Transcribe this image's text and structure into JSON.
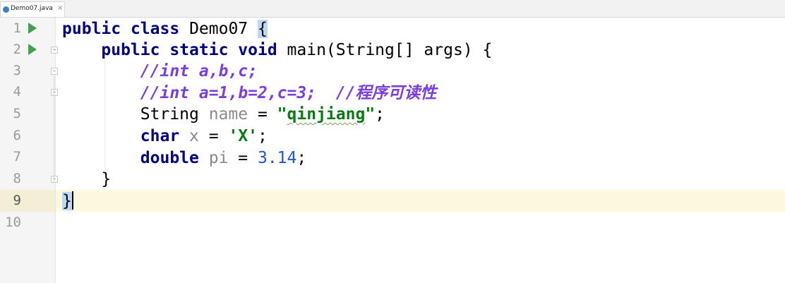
{
  "tab": {
    "filename": "Demo07.java",
    "close": "×",
    "icon": "java-file-icon"
  },
  "lines": [
    "1",
    "2",
    "3",
    "4",
    "5",
    "6",
    "7",
    "8",
    "9",
    "10"
  ],
  "code": {
    "l1": {
      "kw1": "public",
      "kw2": "class",
      "name": "Demo07",
      "brace": "{"
    },
    "l2": {
      "kw1": "public",
      "kw2": "static",
      "kw3": "void",
      "rest": "main(String[] args) {"
    },
    "l3": {
      "comment": "//int a,b,c;"
    },
    "l4": {
      "comment": "//int a=1,b=2,c=3;  //程序可读性"
    },
    "l5": {
      "type": "String",
      "var": "name",
      "eq": " = ",
      "str_open": "\"",
      "str": "qinjiang",
      "str_close": "\"",
      "end": ";"
    },
    "l6": {
      "kw": "char",
      "var": "x",
      "eq": " = ",
      "str": "'X'",
      "end": ";"
    },
    "l7": {
      "kw": "double",
      "var": "pi",
      "eq": " = ",
      "num": "3.14",
      "end": ";"
    },
    "l8": {
      "brace": "}"
    },
    "l9": {
      "brace": "}"
    }
  },
  "colors": {
    "keyword": "#000080",
    "comment": "#7a3ee0",
    "string": "#0a7a16",
    "number": "#1a56e0",
    "current_line": "#fcf7df"
  }
}
